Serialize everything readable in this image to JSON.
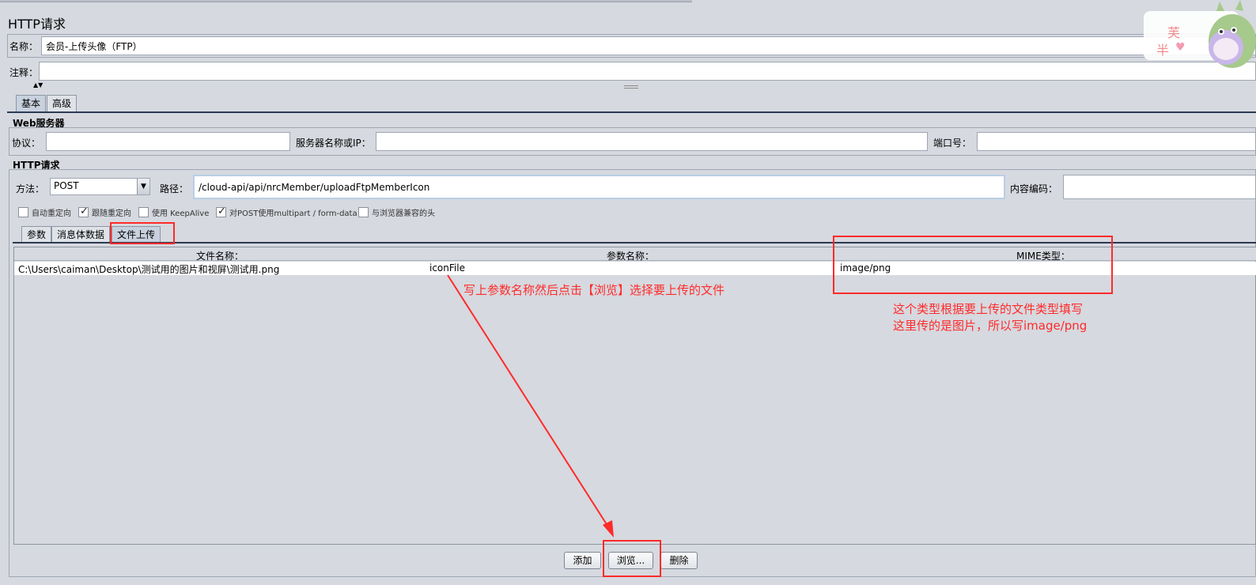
{
  "panel": {
    "title": "HTTP请求",
    "name_label": "名称：",
    "name_value": "会员-上传头像（FTP）",
    "comment_label": "注释：",
    "comment_value": ""
  },
  "top_tabs": [
    "基本",
    "高级"
  ],
  "web_server": {
    "title": "Web服务器",
    "protocol_label": "协议：",
    "protocol_value": "",
    "server_label": "服务器名称或IP：",
    "server_value": "",
    "port_label": "端口号：",
    "port_value": ""
  },
  "http_request": {
    "title": "HTTP请求",
    "method_label": "方法：",
    "method_value": "POST",
    "path_label": "路径：",
    "path_value": "/cloud-api/api/nrcMember/uploadFtpMemberIcon",
    "encoding_label": "内容编码：",
    "encoding_value": ""
  },
  "options": [
    {
      "label": "自动重定向",
      "checked": false
    },
    {
      "label": "跟随重定向",
      "checked": true
    },
    {
      "label": "使用 KeepAlive",
      "checked": false
    },
    {
      "label": "对POST使用multipart / form-data",
      "checked": true
    },
    {
      "label": "与浏览器兼容的头",
      "checked": false
    }
  ],
  "sub_tabs": [
    "参数",
    "消息体数据",
    "文件上传"
  ],
  "file_table": {
    "columns": [
      "文件名称：",
      "参数名称：",
      "MIME类型："
    ],
    "rows": [
      [
        "C:\\Users\\caiman\\Desktop\\测试用的图片和视屏\\测试用.png",
        "iconFile",
        "image/png"
      ]
    ]
  },
  "buttons": {
    "add": "添加",
    "browse": "浏览...",
    "delete": "删除"
  },
  "annotations": {
    "param_note": "写上参数名称然后点击【浏览】选择要上传的文件",
    "mime_note_line1": "这个类型根据要上传的文件类型填写",
    "mime_note_line2": "这里传的是图片，所以写image/png",
    "color": "#ff2a2a"
  },
  "watermark": {
    "chars": [
      "芙",
      "半"
    ]
  }
}
